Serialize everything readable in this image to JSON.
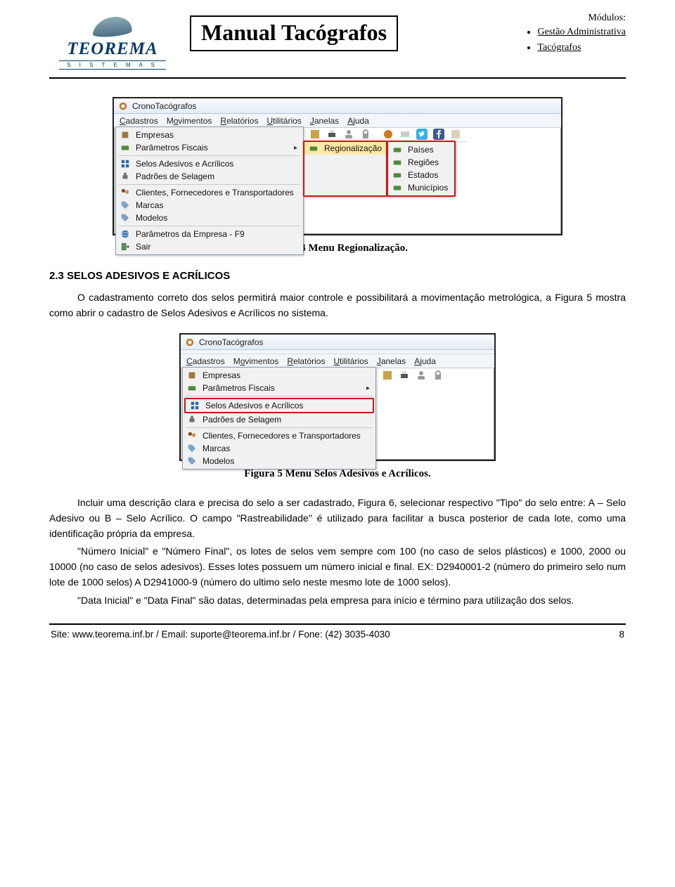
{
  "header": {
    "logo_main": "TEOREMA",
    "logo_sub": "S I S T E M A S",
    "manual_title": "Manual Tacógrafos",
    "modules_label": "Módulos:",
    "modules": [
      "Gestão Administrativa",
      "Tacógrafos"
    ]
  },
  "win1": {
    "title": "CronoTacógrafos",
    "menubar": [
      "Cadastros",
      "Movimentos",
      "Relatórios",
      "Utilitários",
      "Janelas",
      "Ajuda"
    ],
    "col1": [
      "Empresas",
      "Parâmetros Fiscais",
      "Selos Adesivos e Acrílicos",
      "Padrões de Selagem",
      "Clientes, Fornecedores e Transportadores",
      "Marcas",
      "Modelos",
      "Parâmetros da Empresa - F9",
      "Sair"
    ],
    "col2_label": "Regionalização",
    "col3": [
      "Países",
      "Regiões",
      "Estados",
      "Municípios"
    ]
  },
  "caption4": "Figura 4 Menu Regionalização.",
  "section23_title": "2.3 SELOS ADESIVOS E ACRÍLICOS",
  "section23_para": "O cadastramento correto dos selos permitirá maior controle e possibilitará a movimentação metrológica, a Figura 5 mostra como abrir o cadastro de Selos Adesivos e Acrílicos no sistema.",
  "win2": {
    "title": "CronoTacógrafos",
    "menubar": [
      "Cadastros",
      "Movimentos",
      "Relatórios",
      "Utilitários",
      "Janelas",
      "Ajuda"
    ],
    "col1": [
      "Empresas",
      "Parâmetros Fiscais",
      "Selos Adesivos e Acrílicos",
      "Padrões de Selagem",
      "Clientes, Fornecedores e Transportadores",
      "Marcas",
      "Modelos"
    ],
    "highlight_index": 2
  },
  "caption5": "Figura 5 Menu Selos Adesivos e Acrílicos.",
  "body_p1": "Incluir uma descrição clara e precisa do selo a ser cadastrado, Figura 6, selecionar respectivo \"Tipo\" do selo entre: A – Selo Adesivo ou B – Selo Acrílico. O campo \"Rastreabilidade\" é utilizado para facilitar a busca posterior de cada lote, como uma identificação própria da empresa.",
  "body_p2": "\"Número Inicial\" e \"Número Final\", os lotes de selos vem sempre com 100 (no caso de selos plásticos) e 1000, 2000 ou 10000 (no caso de selos adesivos). Esses lotes possuem um número inicial e final. EX: D2940001-2 (número do primeiro selo num lote de 1000 selos) A D2941000-9 (número do ultimo selo neste mesmo lote de 1000 selos).",
  "body_p3": "\"Data Inicial\" e \"Data Final\" são datas, determinadas pela empresa para início e término para utilização dos selos.",
  "footer": {
    "left": "Site: www.teorema.inf.br / Email: suporte@teorema.inf.br / Fone: (42) 3035-4030",
    "page": "8"
  }
}
